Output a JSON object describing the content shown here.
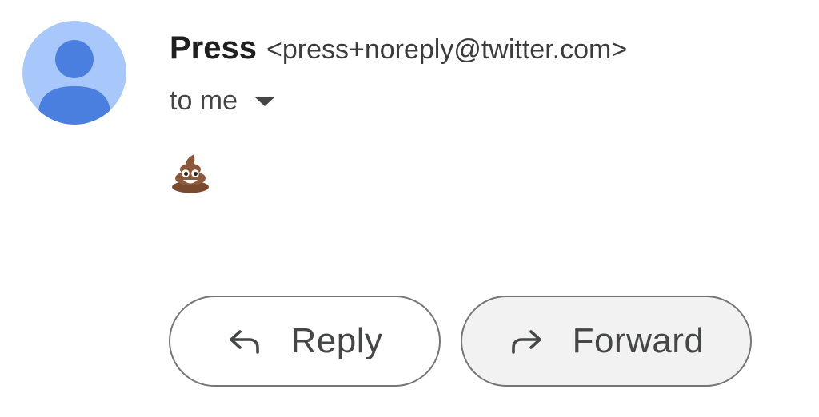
{
  "message": {
    "sender_name": "Press",
    "sender_email": "<press+noreply@twitter.com>",
    "recipient_label": "to me",
    "body_emoji": "💩"
  },
  "actions": {
    "reply_label": "Reply",
    "forward_label": "Forward"
  },
  "icons": {
    "avatar": "person-placeholder-icon",
    "recipient_details": "caret-down-icon",
    "reply": "reply-arrow-icon",
    "forward": "forward-arrow-icon"
  },
  "colors": {
    "avatar_bg": "#a8c7fa",
    "avatar_figure": "#4a7fe0",
    "button_border": "#747775",
    "text_primary": "#1f1f1f",
    "text_secondary": "#444746"
  }
}
